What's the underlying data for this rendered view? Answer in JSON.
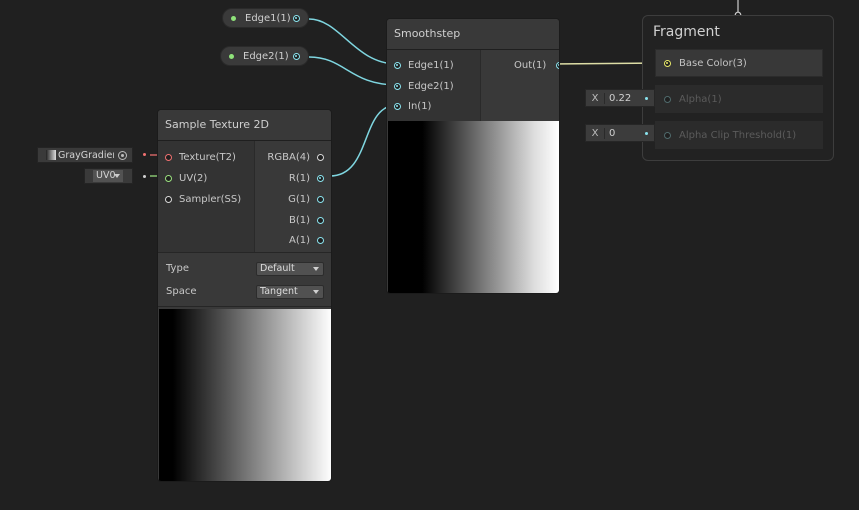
{
  "properties": {
    "edge1": "Edge1(1)",
    "edge2": "Edge2(1)"
  },
  "smoothstep": {
    "title": "Smoothstep",
    "inputs": [
      "Edge1(1)",
      "Edge2(1)",
      "In(1)"
    ],
    "output": "Out(1)"
  },
  "sample_texture": {
    "title": "Sample Texture 2D",
    "inputs": [
      "Texture(T2)",
      "UV(2)",
      "Sampler(SS)"
    ],
    "outputs": [
      "RGBA(4)",
      "R(1)",
      "G(1)",
      "B(1)",
      "A(1)"
    ],
    "type_label": "Type",
    "type_value": "Default",
    "space_label": "Space",
    "space_value": "Tangent"
  },
  "inline_inputs": {
    "texture_name": "GrayGradient",
    "uv_value": "UV0"
  },
  "fragment": {
    "title": "Fragment",
    "base_color": "Base Color(3)",
    "alpha": "Alpha(1)",
    "alpha_clip": "Alpha Clip Threshold(1)",
    "alpha_x_label": "X",
    "alpha_value": "0.22",
    "clip_x_label": "X",
    "clip_value": "0"
  },
  "colors": {
    "background": "#202020",
    "float_wire": "#7fd6e0",
    "vector3_wire": "#e6e6a0",
    "texture_port": "#f07070",
    "uv_port": "#9be27f"
  }
}
